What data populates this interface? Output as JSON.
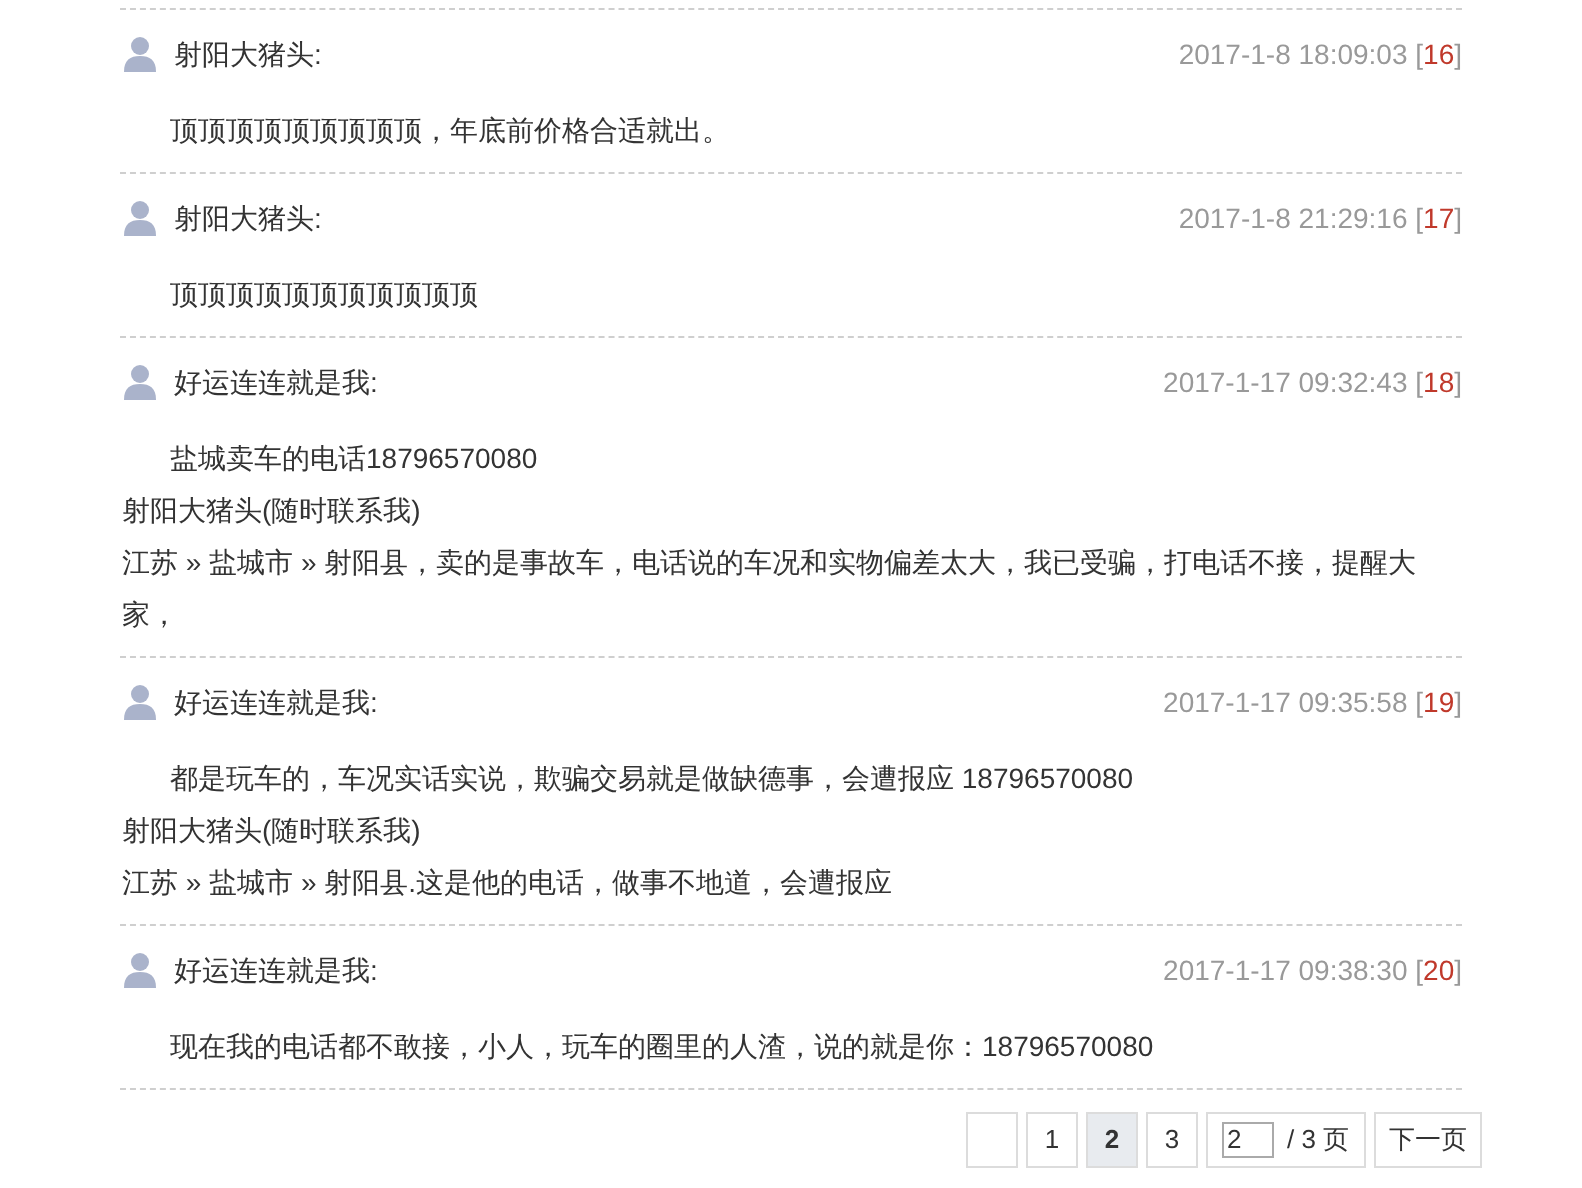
{
  "posts": [
    {
      "author": "射阳大猪头:",
      "time": "2017-1-8 18:09:03",
      "floor_open": "[",
      "floor": "16",
      "floor_close": "]",
      "body": "顶顶顶顶顶顶顶顶顶，年底前价格合适就出。"
    },
    {
      "author": "射阳大猪头:",
      "time": "2017-1-8 21:29:16",
      "floor_open": "[",
      "floor": "17",
      "floor_close": "]",
      "body": "顶顶顶顶顶顶顶顶顶顶顶"
    },
    {
      "author": "好运连连就是我:",
      "time": "2017-1-17 09:32:43",
      "floor_open": "[",
      "floor": "18",
      "floor_close": "]",
      "body": "盐城卖车的电话18796570080",
      "extra_lines": [
        "射阳大猪头(随时联系我)",
        "江苏 » 盐城市 » 射阳县，卖的是事故车，电话说的车况和实物偏差太大，我已受骗，打电话不接，提醒大家，"
      ]
    },
    {
      "author": "好运连连就是我:",
      "time": "2017-1-17 09:35:58",
      "floor_open": "[",
      "floor": "19",
      "floor_close": "]",
      "body": "都是玩车的，车况实话实说，欺骗交易就是做缺德事，会遭报应 18796570080",
      "extra_lines": [
        "射阳大猪头(随时联系我)",
        "江苏 » 盐城市 » 射阳县.这是他的电话，做事不地道，会遭报应"
      ]
    },
    {
      "author": "好运连连就是我:",
      "time": "2017-1-17 09:38:30",
      "floor_open": "[",
      "floor": "20",
      "floor_close": "]",
      "body": "现在我的电话都不敢接，小人，玩车的圈里的人渣，说的就是你：18796570080"
    }
  ],
  "pagination": {
    "pages": [
      {
        "label": "1",
        "selected": false
      },
      {
        "label": "2",
        "selected": true
      },
      {
        "label": "3",
        "selected": false
      }
    ],
    "jump_value": "2",
    "total": "/ 3 页",
    "next": "下一页"
  }
}
